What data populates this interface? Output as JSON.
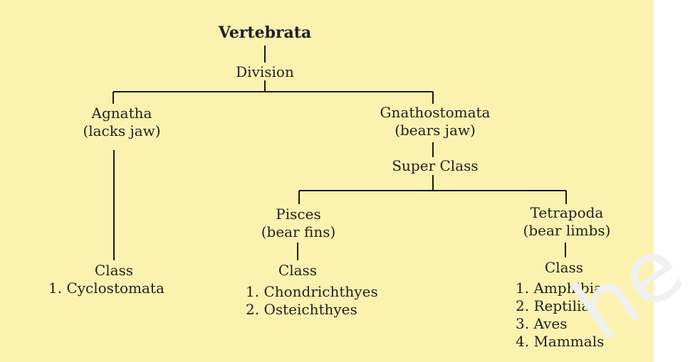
{
  "diagram": {
    "root": "Vertebrata",
    "division_label": "Division",
    "agnatha": {
      "name": "Agnatha",
      "note": "(lacks jaw)",
      "class_label": "Class",
      "classes": [
        "1. Cyclostomata"
      ]
    },
    "gnathostomata": {
      "name": "Gnathostomata",
      "note": "(bears jaw)",
      "super_class_label": "Super Class"
    },
    "pisces": {
      "name": "Pisces",
      "note": "(bear fins)",
      "class_label": "Class",
      "classes": [
        "1. Chondrichthyes",
        "2. Osteichthyes"
      ]
    },
    "tetrapoda": {
      "name": "Tetrapoda",
      "note": "(bear limbs)",
      "class_label": "Class",
      "classes": [
        "1. Amphibia",
        "2. Reptilia",
        "3. Aves",
        "4. Mammals"
      ]
    }
  }
}
